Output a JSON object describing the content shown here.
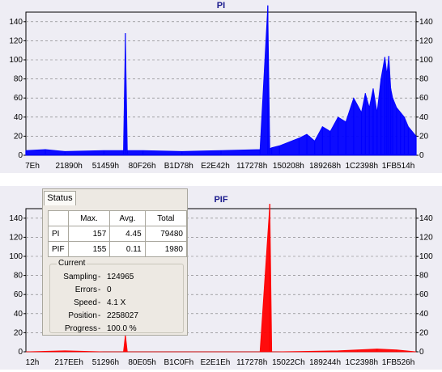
{
  "top_chart": {
    "title": "PI",
    "y_ticks": [
      "0",
      "20",
      "40",
      "60",
      "80",
      "100",
      "120",
      "140"
    ],
    "x_ticks": [
      "7Eh",
      "21890h",
      "51459h",
      "80F26h",
      "B1D78h",
      "E2E42h",
      "117278h",
      "150208h",
      "189268h",
      "1C2398h",
      "1FB514h"
    ]
  },
  "bottom_chart": {
    "title": "PIF",
    "y_ticks": [
      "0",
      "20",
      "40",
      "60",
      "80",
      "100",
      "120",
      "140"
    ],
    "x_ticks": [
      "12h",
      "217EEh",
      "51296h",
      "80E05h",
      "B1C0Fh",
      "E2E1Eh",
      "117278h",
      "15022Ch",
      "189244h",
      "1C2398h",
      "1FB526h"
    ]
  },
  "colors": {
    "pi_series": "#0000ff",
    "pif_series": "#ff0000",
    "plot_bg": "#eeedf4",
    "title": "#1a1a8c"
  },
  "status": {
    "tab_label": "Status",
    "table": {
      "headers": [
        "",
        "Max.",
        "Avg.",
        "Total"
      ],
      "rows": [
        {
          "label": "PI",
          "max": "157",
          "avg": "4.45",
          "total": "79480"
        },
        {
          "label": "PIF",
          "max": "155",
          "avg": "0.11",
          "total": "1980"
        }
      ]
    },
    "current": {
      "title": "Current",
      "fields": [
        {
          "label": "Sampling",
          "value": "124965"
        },
        {
          "label": "Errors",
          "value": "0"
        },
        {
          "label": "Speed",
          "value": "4.1  X"
        },
        {
          "label": "Position",
          "value": "2258027"
        },
        {
          "label": "Progress",
          "value": "100.0 %"
        }
      ]
    }
  },
  "chart_data": [
    {
      "type": "area",
      "title": "PI",
      "x_tick_labels": [
        "7Eh",
        "21890h",
        "51459h",
        "80F26h",
        "B1D78h",
        "E2E42h",
        "117278h",
        "150208h",
        "189268h",
        "1C2398h",
        "1FB514h"
      ],
      "ylim": [
        0,
        150
      ],
      "y_ticks": [
        0,
        20,
        40,
        60,
        80,
        100,
        120,
        140
      ],
      "grid": true,
      "series": [
        {
          "x_fraction": [
            0.0,
            0.05,
            0.1,
            0.2,
            0.25,
            0.255,
            0.26,
            0.3,
            0.4,
            0.5,
            0.6,
            0.62,
            0.625,
            0.63,
            0.65,
            0.7,
            0.72,
            0.74,
            0.76,
            0.78,
            0.8,
            0.82,
            0.84,
            0.86,
            0.87,
            0.88,
            0.89,
            0.9,
            0.91,
            0.92,
            0.925,
            0.93,
            0.935,
            0.94,
            0.95,
            0.96,
            0.97,
            0.98,
            1.0
          ],
          "values": [
            5,
            6,
            4,
            5,
            5,
            128,
            5,
            5,
            4,
            5,
            6,
            157,
            7,
            8,
            10,
            18,
            22,
            15,
            30,
            25,
            40,
            35,
            60,
            45,
            65,
            50,
            70,
            45,
            80,
            103,
            85,
            104,
            70,
            60,
            50,
            45,
            40,
            30,
            20
          ]
        }
      ]
    },
    {
      "type": "area",
      "title": "PIF",
      "x_tick_labels": [
        "12h",
        "217EEh",
        "51296h",
        "80E05h",
        "B1C0Fh",
        "E2E1Eh",
        "117278h",
        "15022Ch",
        "189244h",
        "1C2398h",
        "1FB526h"
      ],
      "ylim": [
        0,
        150
      ],
      "y_ticks": [
        0,
        20,
        40,
        60,
        80,
        100,
        120,
        140
      ],
      "grid": true,
      "series": [
        {
          "x_fraction": [
            0.0,
            0.1,
            0.2,
            0.25,
            0.255,
            0.26,
            0.4,
            0.6,
            0.625,
            0.63,
            0.64,
            0.8,
            0.85,
            0.9,
            0.95,
            1.0
          ],
          "values": [
            0,
            1,
            0,
            0,
            18,
            0,
            0,
            0,
            155,
            0,
            0,
            1,
            2,
            3,
            2,
            0
          ]
        }
      ]
    }
  ]
}
